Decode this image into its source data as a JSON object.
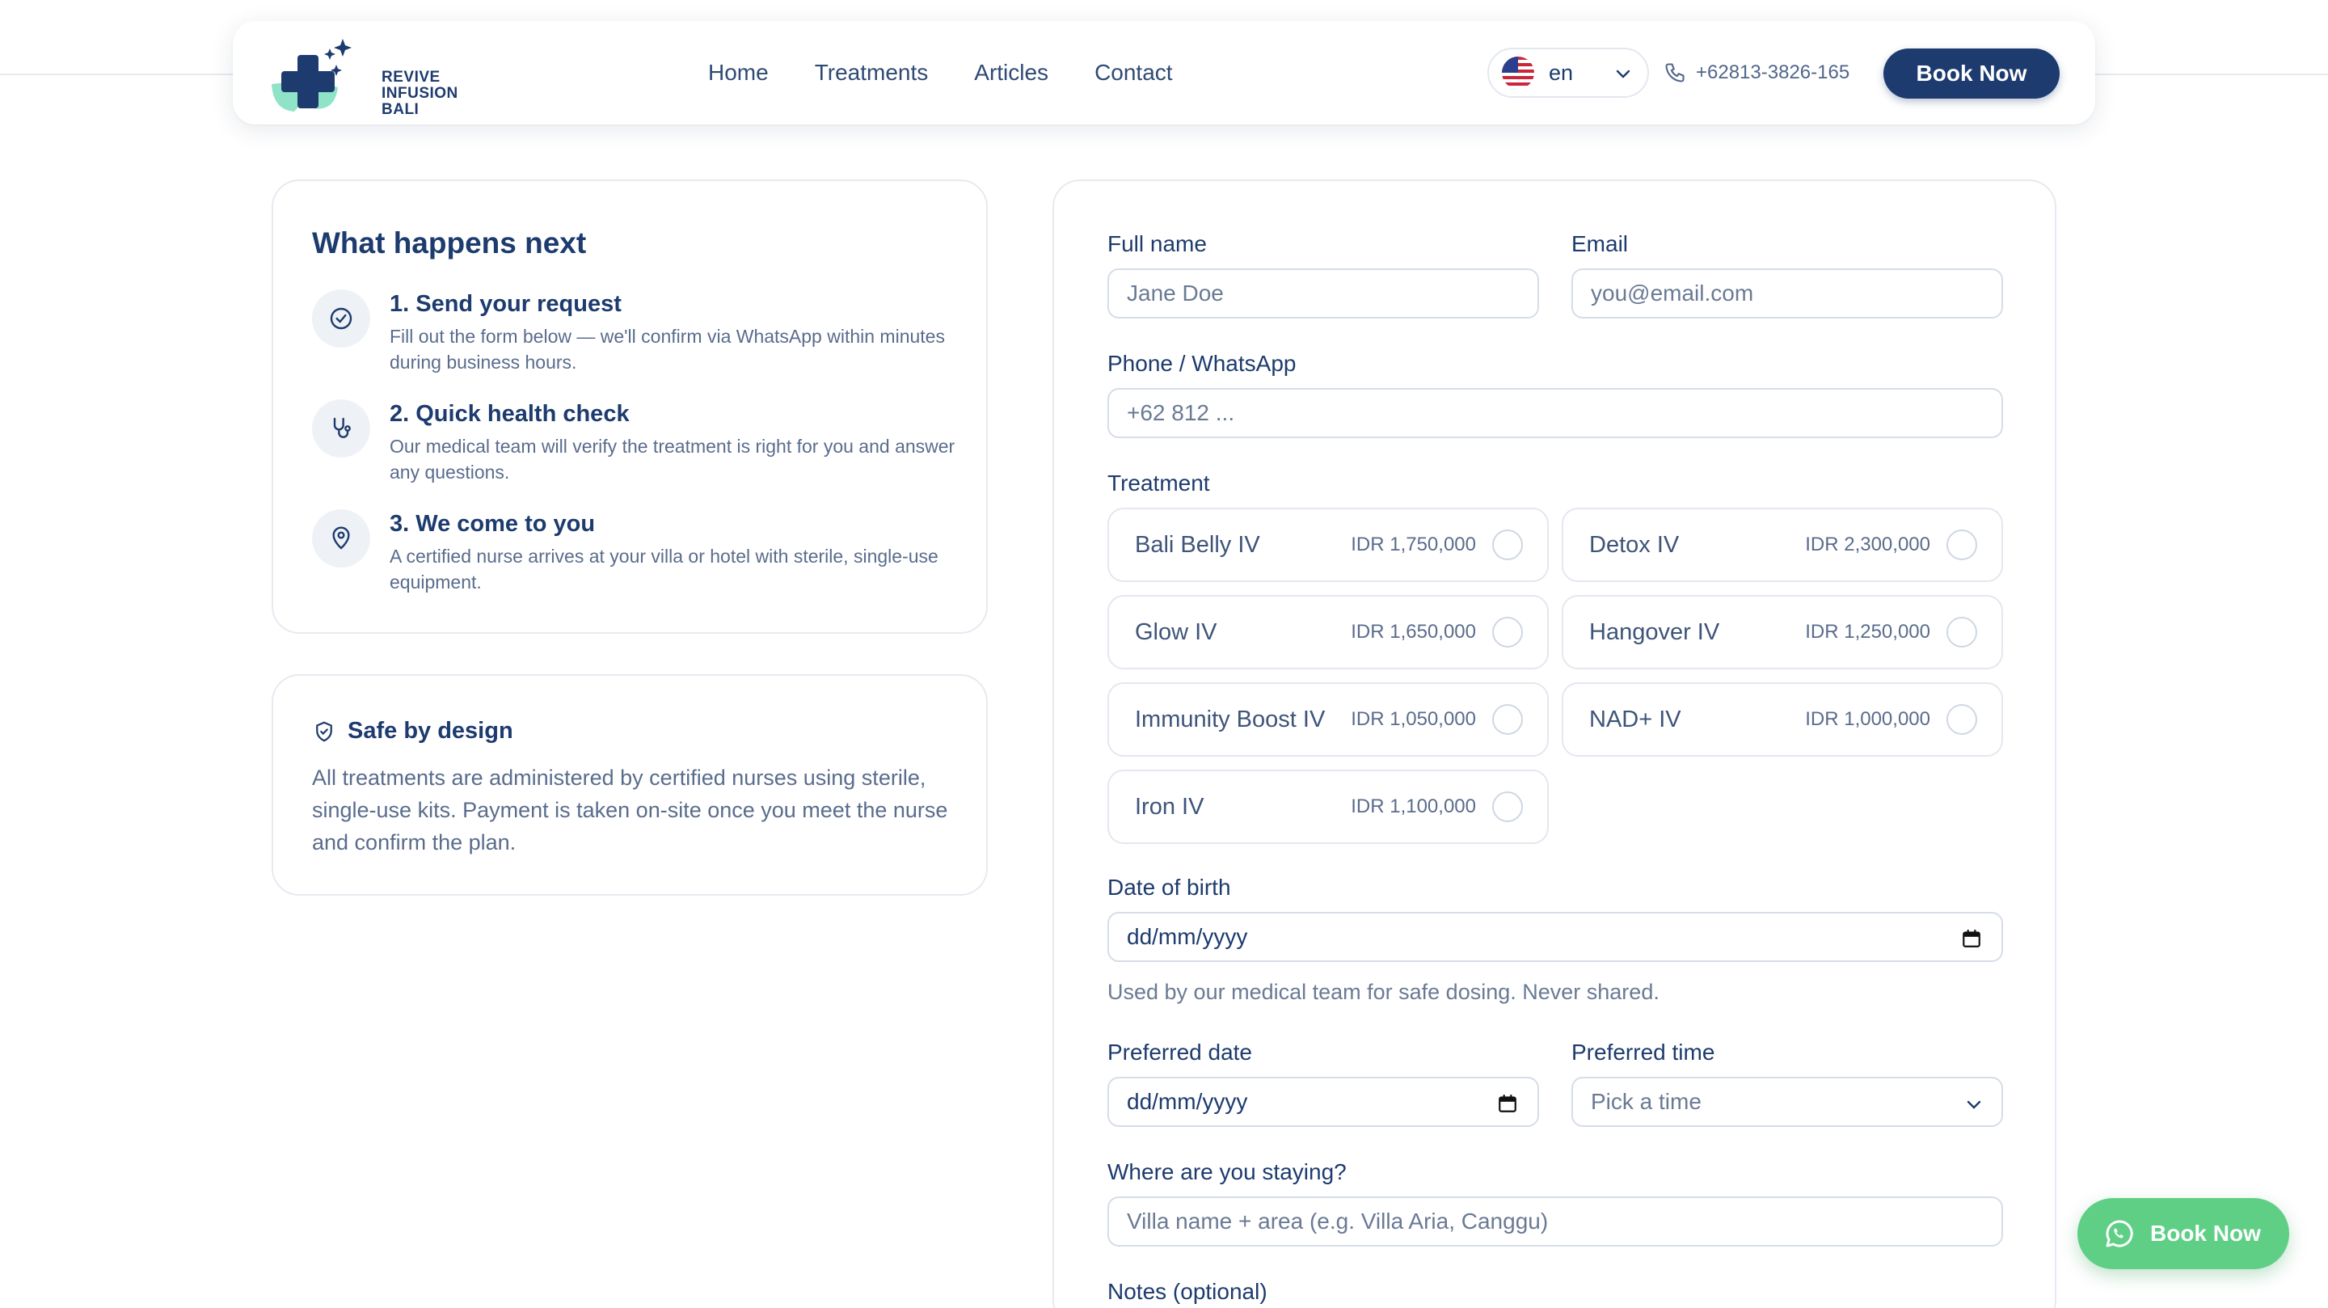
{
  "brand": {
    "logo_text_lines": [
      "REVIVE",
      "INFUSION",
      "BALI"
    ]
  },
  "nav": {
    "items": [
      "Home",
      "Treatments",
      "Articles",
      "Contact"
    ]
  },
  "header": {
    "language": "en",
    "phone": "+62813-3826-165",
    "book_label": "Book Now"
  },
  "steps": {
    "title": "What happens next",
    "items": [
      {
        "icon": "check-circle-icon",
        "title": "1. Send your request",
        "desc": "Fill out the form below — we'll confirm via WhatsApp within minutes during business hours."
      },
      {
        "icon": "stethoscope-icon",
        "title": "2. Quick health check",
        "desc": "Our medical team will verify the treatment is right for you and answer any questions."
      },
      {
        "icon": "map-pin-icon",
        "title": "3. We come to you",
        "desc": "A certified nurse arrives at your villa or hotel with sterile, single-use equipment."
      }
    ]
  },
  "safe": {
    "title": "Safe by design",
    "desc": "All treatments are administered by certified nurses using sterile, single-use kits. Payment is taken on-site once you meet the nurse and confirm the plan."
  },
  "form": {
    "full_name": {
      "label": "Full name",
      "placeholder": "Jane Doe"
    },
    "email": {
      "label": "Email",
      "placeholder": "you@email.com"
    },
    "phone": {
      "label": "Phone / WhatsApp",
      "placeholder": "+62 812 ..."
    },
    "treatment_label": "Treatment",
    "treatments": [
      {
        "name": "Bali Belly IV",
        "price": "IDR 1,750,000"
      },
      {
        "name": "Detox IV",
        "price": "IDR 2,300,000"
      },
      {
        "name": "Glow IV",
        "price": "IDR 1,650,000"
      },
      {
        "name": "Hangover IV",
        "price": "IDR 1,250,000"
      },
      {
        "name": "Immunity Boost IV",
        "price": "IDR 1,050,000"
      },
      {
        "name": "NAD+ IV",
        "price": "IDR 1,000,000"
      },
      {
        "name": "Iron IV",
        "price": "IDR 1,100,000"
      }
    ],
    "dob": {
      "label": "Date of birth",
      "value": "dd/mm/yyyy",
      "hint": "Used by our medical team for safe dosing. Never shared."
    },
    "preferred_date": {
      "label": "Preferred date",
      "value": "dd/mm/yyyy"
    },
    "preferred_time": {
      "label": "Preferred time",
      "value": "Pick a time"
    },
    "staying": {
      "label": "Where are you staying?",
      "placeholder": "Villa name + area (e.g. Villa Aria, Canggu)"
    },
    "notes": {
      "label": "Notes (optional)"
    }
  },
  "whatsapp": {
    "label": "Book Now"
  },
  "colors": {
    "primary": "#1d3b6e",
    "accent_green": "#5fcf86",
    "logo_teal": "#8fe3c6"
  }
}
